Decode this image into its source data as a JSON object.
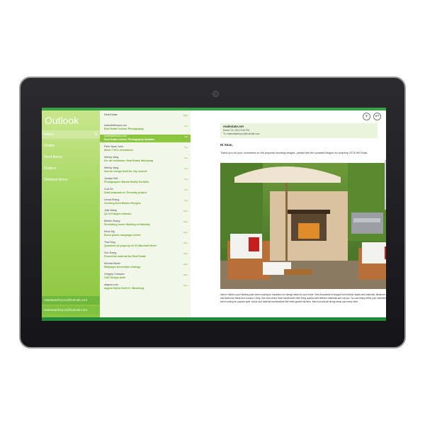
{
  "app": {
    "title": "Outlook"
  },
  "nav": {
    "items": [
      {
        "label": "Inbox",
        "count": "5"
      },
      {
        "label": "Drafts"
      },
      {
        "label": "Sent items"
      },
      {
        "label": "Outbox"
      },
      {
        "label": "Deleted items"
      }
    ],
    "accounts": [
      "realestateforyou@hotmail.com",
      "realestateforyou@hotmail.com"
    ]
  },
  "messages": [
    {
      "sender": "Real Estate",
      "subject": "",
      "time": "Web"
    },
    {
      "sender": "realestateforyou.net",
      "subject": "Real Estate Interior Photography",
      "time": "Tue"
    },
    {
      "sender": "realestateforyou.net",
      "subject": "Real Estate Interior Photography Updates",
      "time": "Sat"
    },
    {
      "sender": "Peter Ryan John",
      "subject": "Week + 50% investment",
      "time": "Tue"
    },
    {
      "sender": "Wendy Vang",
      "subject": "For the Invitation: Real Estate Workshop",
      "time": "Tue"
    },
    {
      "sender": "Wendy Vang",
      "subject": "Interior design draft for city council",
      "time": "Tue"
    },
    {
      "sender": "Jocelyn Wei",
      "subject": "Photographer Manlat Realty Portfolio",
      "time": "Tue"
    },
    {
      "sender": "Curt Oh",
      "subject": "Draft proposal on Thursday project",
      "time": "Tue"
    },
    {
      "sender": "Leona Shang",
      "subject": "Greeting from Marlon Rengels",
      "time": "Tue"
    },
    {
      "sender": "Julie Wang",
      "subject": "Q2 sell target estimate",
      "time": "Mon"
    },
    {
      "sender": "Bubble Zhang",
      "subject": "Reminding email: Meeting on Monday",
      "time": "Mon"
    },
    {
      "sender": "Kevin Ng",
      "subject": "Block power campaign review",
      "time": "Mon"
    },
    {
      "sender": "Tina Tang",
      "subject": "Quotation of property on 51 Marshall street",
      "time": "Mon"
    },
    {
      "sender": "Zoe Zhang",
      "subject": "Promotion material for Real Estate",
      "time": "Mon"
    },
    {
      "sender": "Michael Muller",
      "subject": "Wallpaper decoration strategy",
      "time": "Mon"
    },
    {
      "sender": "Gregory Cranston",
      "subject": "CAD Design draft",
      "time": "Mon"
    },
    {
      "sender": "aegeon.com",
      "subject": "august Stylist Keith E. Washburg",
      "time": "Mon"
    }
  ],
  "email": {
    "from": "realestate.net",
    "date": "March 19, 2014  9:06 PM",
    "to": "To: realestateforyou@hotmail.com",
    "greeting": "Hi Sean,",
    "intro": "Thank you for your comments on the property shooting images, please see the updated images for property 207A Hill Road.",
    "body": "Interior Ideas is your starting point when looking for inspiration on design ideas for your home. View thousands of images from Kitchen styles and materials, Bedroom and Bathroom ideas and Outdoor Living. See how others have transformed their living spaces with different materials and colours. You can easily refine your selection when looking for popular style, colour and material combinations like white granite kitchens, french provincial dining areas and many more"
  },
  "colors": {
    "accent": "#8cc63f",
    "nav_top": "#c8e68b",
    "bar": "#238a3c"
  },
  "icons": [
    "add-icon",
    "reply-icon",
    "delete-icon"
  ]
}
